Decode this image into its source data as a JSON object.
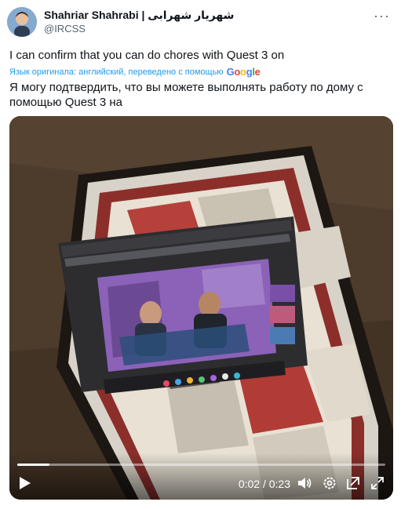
{
  "author": {
    "display_name": "Shahriar Shahrabi | شهریار شهرابی",
    "handle": "@IRCSS"
  },
  "tweet": {
    "text": "I can confirm that you can do chores with Quest 3 on",
    "translation_note": "Язык оригинала: английский, переведено с помощью",
    "translation_provider": {
      "g": "G",
      "o1": "o",
      "o2": "o",
      "g2": "g",
      "l": "l",
      "e": "e"
    },
    "translated_text": "Я могу подтвердить, что вы можете выполнять работу по дому с помощью Quest 3 на"
  },
  "video": {
    "current_time": "0:02",
    "separator": " / ",
    "duration": "0:23",
    "progress_fraction": 0.087
  },
  "icons": {
    "more": "more-horizontal-icon",
    "play": "play-icon",
    "volume": "volume-icon",
    "settings": "gear-icon",
    "picture_in_picture": "pip-icon",
    "fullscreen": "fullscreen-icon"
  },
  "colors": {
    "link": "#1d9bf0",
    "text": "#0f1419",
    "secondary": "#536471"
  }
}
